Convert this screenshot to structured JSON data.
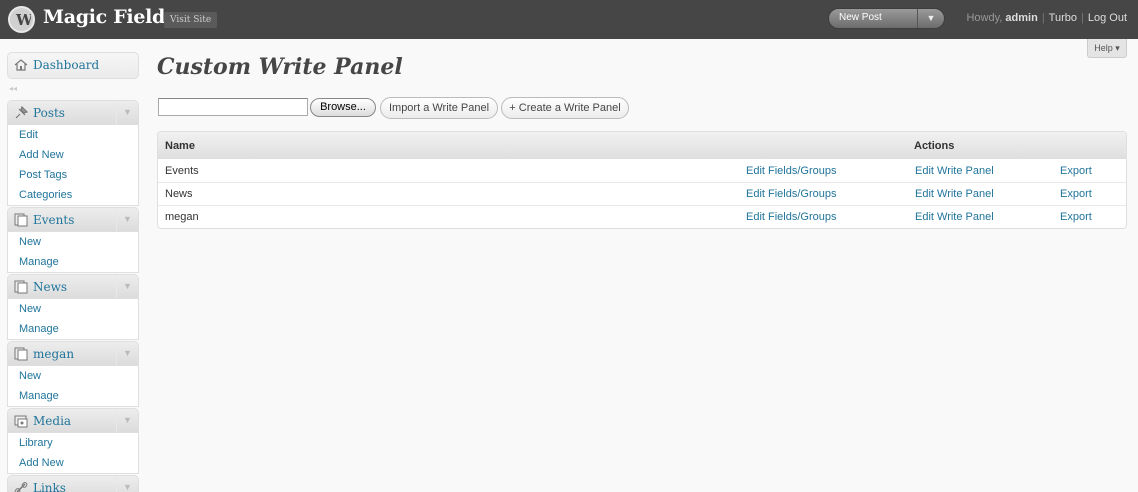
{
  "header": {
    "site_title": "Magic Fields",
    "visit_site": "Visit Site",
    "new_post": "New Post",
    "greeting": "Howdy,",
    "user": "admin",
    "turbo": "Turbo",
    "logout": "Log Out"
  },
  "help": {
    "label": "Help"
  },
  "sidebar": {
    "dashboard": "Dashboard",
    "menus": [
      {
        "label": "Posts",
        "icon": "pushpin-icon",
        "items": [
          "Edit",
          "Add New",
          "Post Tags",
          "Categories"
        ]
      },
      {
        "label": "Events",
        "icon": "pages-icon",
        "items": [
          "New",
          "Manage"
        ]
      },
      {
        "label": "News",
        "icon": "pages-icon",
        "items": [
          "New",
          "Manage"
        ]
      },
      {
        "label": "megan",
        "icon": "pages-icon",
        "items": [
          "New",
          "Manage"
        ]
      },
      {
        "label": "Media",
        "icon": "media-icon",
        "items": [
          "Library",
          "Add New"
        ]
      },
      {
        "label": "Links",
        "icon": "link-icon",
        "items": []
      }
    ]
  },
  "main": {
    "title": "Custom Write Panel",
    "browse": "Browse...",
    "import_button": "Import a Write Panel",
    "create_button": "+ Create a Write Panel",
    "table": {
      "col_name": "Name",
      "col_actions": "Actions",
      "rows": [
        {
          "name": "Events",
          "edit_fields": "Edit Fields/Groups",
          "edit_panel": "Edit Write Panel",
          "export": "Export"
        },
        {
          "name": "News",
          "edit_fields": "Edit Fields/Groups",
          "edit_panel": "Edit Write Panel",
          "export": "Export"
        },
        {
          "name": "megan",
          "edit_fields": "Edit Fields/Groups",
          "edit_panel": "Edit Write Panel",
          "export": "Export"
        }
      ]
    }
  },
  "colors": {
    "header_bg": "#464646",
    "link": "#21759b",
    "page_bg": "#f9f9f9"
  }
}
